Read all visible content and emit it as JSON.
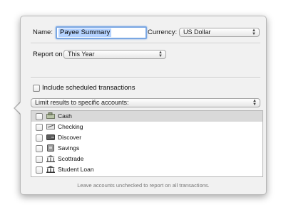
{
  "form": {
    "name_label": "Name:",
    "name_value": "Payee Summary",
    "currency_label": "Currency:",
    "currency_value": "US Dollar",
    "report_on_label": "Report on",
    "report_on_value": "This Year",
    "include_scheduled_label": "Include scheduled transactions",
    "include_scheduled_checked": false,
    "limit_results_value": "Limit results to specific accounts:"
  },
  "accounts": [
    {
      "name": "Cash",
      "icon": "cash-icon",
      "checked": false,
      "selected": true
    },
    {
      "name": "Checking",
      "icon": "checkbook-icon",
      "checked": false,
      "selected": false
    },
    {
      "name": "Discover",
      "icon": "wallet-icon",
      "checked": false,
      "selected": false
    },
    {
      "name": "Savings",
      "icon": "piggy-bank-icon",
      "checked": false,
      "selected": false
    },
    {
      "name": "Scottrade",
      "icon": "bank-building-icon",
      "checked": false,
      "selected": false
    },
    {
      "name": "Student Loan",
      "icon": "bank-building-icon",
      "checked": false,
      "selected": false
    }
  ],
  "footer_note": "Leave accounts unchecked to report on all transactions.",
  "colors": {
    "selection_highlight": "#b5d3ff",
    "focus_ring": "#7aa7e3",
    "selected_row": "#d9d9d9"
  }
}
